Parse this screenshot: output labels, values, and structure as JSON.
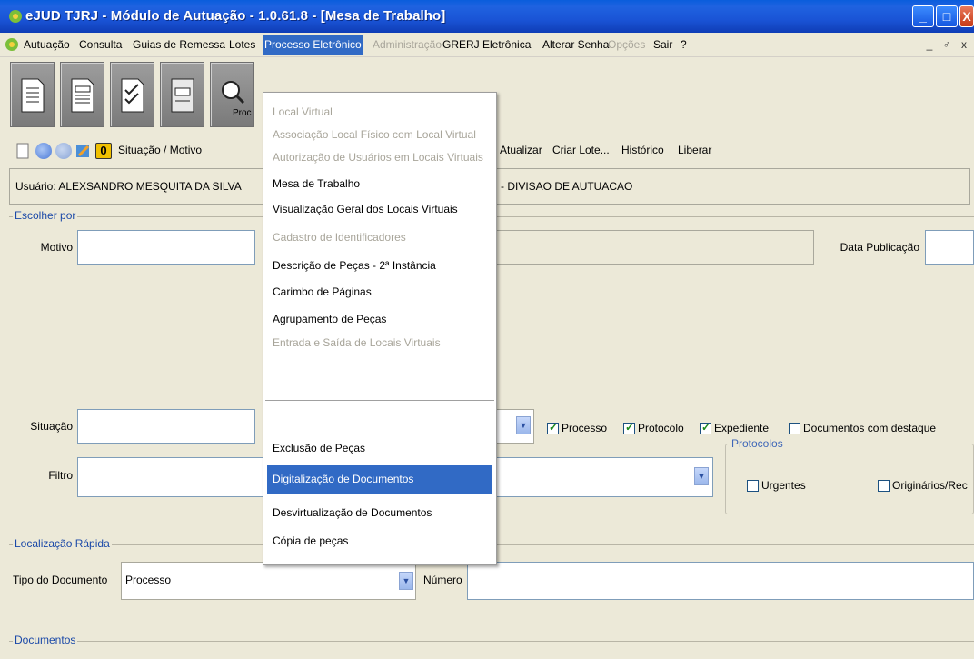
{
  "window": {
    "title": "eJUD TJRJ - Módulo de Autuação - 1.0.61.8 - [Mesa de Trabalho]",
    "buttons": {
      "minimize": "_",
      "maximize": "□",
      "close": "X"
    },
    "right_controls": "_ ♂ x"
  },
  "menubar": {
    "items": [
      {
        "label": "Autuação",
        "disabled": false
      },
      {
        "label": "Consulta",
        "disabled": false
      },
      {
        "label": "Guias de Remessa",
        "disabled": false
      },
      {
        "label": "Lotes",
        "disabled": false
      },
      {
        "label": "Processo Eletrônico",
        "disabled": false,
        "open": true
      },
      {
        "label": "Administração",
        "disabled": true
      },
      {
        "label": "GRERJ Eletrônica",
        "disabled": false
      },
      {
        "label": "Alterar Senha",
        "disabled": false
      },
      {
        "label": "Opções",
        "disabled": true
      },
      {
        "label": "Sair",
        "disabled": false
      },
      {
        "label": "?",
        "disabled": false
      }
    ]
  },
  "toolbar": {
    "buttons": [
      {
        "name": "document-icon"
      },
      {
        "name": "document-list-icon"
      },
      {
        "name": "checklist-icon"
      },
      {
        "name": "form-icon"
      },
      {
        "name": "search-process-icon",
        "label": "Proc"
      }
    ]
  },
  "navbar": {
    "situacao_motivo": "Situação / Motivo",
    "atualizar": "Atualizar",
    "criar_lote": "Criar Lote...",
    "historico": "Histórico",
    "liberar": "Liberar",
    "counter": "0"
  },
  "user": {
    "label": "Usuário: ALEXSANDRO MESQUITA DA SILVA",
    "division": "- DIVISAO DE AUTUACAO"
  },
  "escolher_por": {
    "title": "Escolher por",
    "motivo_label": "Motivo",
    "situacao_label": "Situação",
    "filtro_label": "Filtro",
    "data_publicacao_label": "Data Publicação",
    "checks": [
      {
        "label": "Processo",
        "checked": true
      },
      {
        "label": "Protocolo",
        "checked": true
      },
      {
        "label": "Expediente",
        "checked": true
      },
      {
        "label": "Documentos com destaque",
        "checked": false
      }
    ],
    "protocolos": {
      "title": "Protocolos",
      "urgentes": {
        "label": "Urgentes",
        "checked": false
      },
      "originarios": {
        "label": "Originários/Rec",
        "checked": false
      }
    }
  },
  "localizacao_rapida": {
    "title": "Localização Rápida",
    "tipo_documento_label": "Tipo do Documento",
    "tipo_documento_value": "Processo",
    "numero_label": "Número"
  },
  "documentos": {
    "title": "Documentos"
  },
  "dropdown": {
    "items": [
      {
        "label": "Local Virtual",
        "disabled": true
      },
      {
        "label": "Associação Local Físico com Local Virtual",
        "disabled": true
      },
      {
        "label": "Autorização de Usuários em Locais Virtuais",
        "disabled": true
      },
      {
        "label": "Mesa de Trabalho",
        "disabled": false
      },
      {
        "label": "Visualização Geral dos Locais Virtuais",
        "disabled": false
      },
      {
        "label": "Cadastro de Identificadores",
        "disabled": true
      },
      {
        "label": "Descrição de Peças - 2ª Instância",
        "disabled": false
      },
      {
        "label": "Carimbo de Páginas",
        "disabled": false
      },
      {
        "label": "Agrupamento de Peças",
        "disabled": false
      },
      {
        "label": "Entrada e Saída de Locais Virtuais",
        "disabled": true
      },
      {
        "label": "Exclusão de Peças",
        "disabled": false
      },
      {
        "label": "Digitalização de Documentos",
        "disabled": false,
        "selected": true
      },
      {
        "label": "Desvirtualização de Documentos",
        "disabled": false
      },
      {
        "label": "Cópia de peças",
        "disabled": false
      }
    ]
  },
  "colors": {
    "titlebar": "#1a54d6",
    "highlight": "#316ac5",
    "group_title": "#1b49a8",
    "window_bg": "#ece9d8"
  }
}
